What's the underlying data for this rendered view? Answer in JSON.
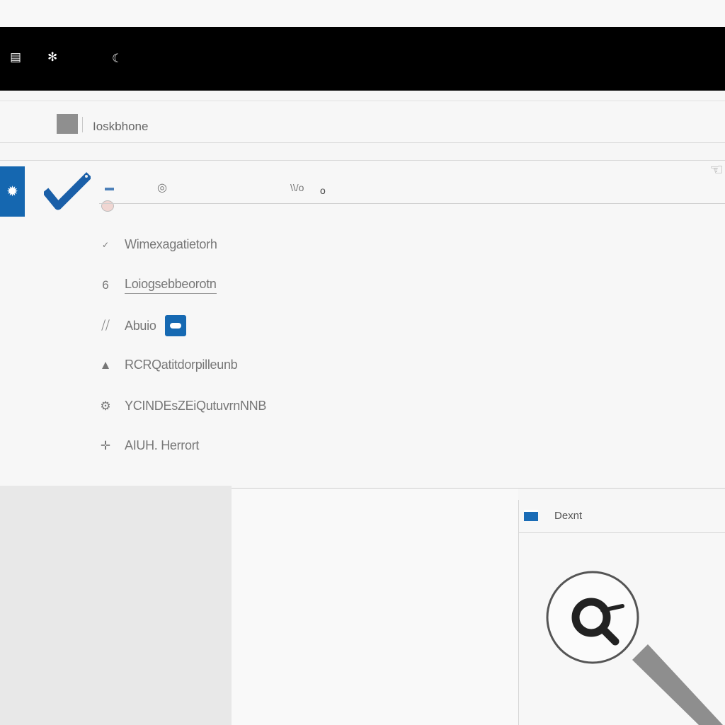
{
  "window": {
    "topbar_icons": [
      "document-icon",
      "gear-icon",
      "moon-icon"
    ]
  },
  "address_bar": {
    "text": "Ioskbhone"
  },
  "toolbar": {
    "label_a": "\\\\/o",
    "accent_color": "#1567b0"
  },
  "menu": {
    "items": [
      {
        "label": "Wimexagatietorh",
        "icon": "check-mark-icon"
      },
      {
        "label": "Loiogsebbeorotn",
        "icon": "swirl-icon"
      },
      {
        "label": "Abuio",
        "icon": "quote-icon"
      },
      {
        "label": "RCRQatitdorpilleunb",
        "icon": "stack-icon"
      },
      {
        "label": "YCINDEsZEiQutuvrnNNB",
        "icon": "settings-icon"
      },
      {
        "label": "AIUH. Herrort",
        "icon": "crosshair-icon"
      }
    ]
  },
  "side_pane": {
    "title": "Dexnt"
  }
}
